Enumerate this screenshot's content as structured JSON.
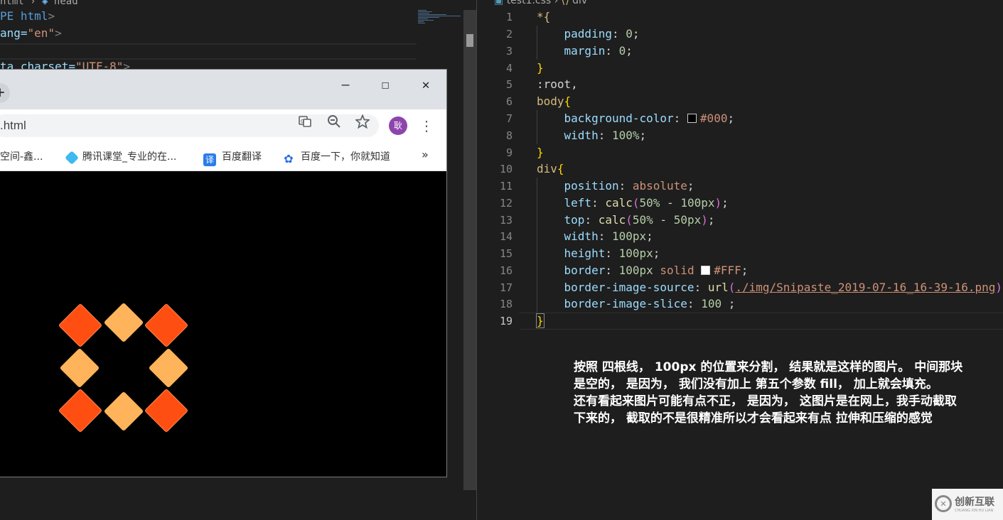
{
  "left_editor": {
    "breadcrumb": {
      "file": "html",
      "sep": "›",
      "node": "head"
    },
    "lines": [
      {
        "a": "PE",
        "b": "html",
        "c": ">"
      },
      {
        "a": "ang=",
        "b": "\"en\"",
        "c": ">"
      },
      {
        "a": "ta charset=",
        "b": "\"UTF-8\"",
        "c": ">"
      }
    ]
  },
  "browser": {
    "url": ".html",
    "window_buttons": {
      "minimize": "—",
      "maximize": "☐",
      "close": "✕"
    },
    "profile_initial": "耿",
    "bookmarks": [
      {
        "label": "空间-鑫...",
        "icon": ""
      },
      {
        "label": "腾讯课堂_专业的在...",
        "icon": "◆"
      },
      {
        "label": "百度翻译",
        "icon": "译"
      },
      {
        "label": "百度一下，你就知道",
        "icon": "✿"
      }
    ],
    "more_bookmarks": "»"
  },
  "right_editor": {
    "breadcrumb": {
      "file": "test1.css",
      "sep": "›",
      "node": "div"
    },
    "line_numbers": [
      "1",
      "2",
      "3",
      "4",
      "5",
      "6",
      "7",
      "8",
      "9",
      "10",
      "11",
      "12",
      "13",
      "14",
      "15",
      "16",
      "17",
      "18",
      "19"
    ],
    "code": {
      "l1": "*{",
      "l2_prop": "padding",
      "l2_val": "0",
      "l3_prop": "margin",
      "l3_val": "0",
      "l4": "}",
      "l5": ":root,",
      "l6_sel": "body",
      "l6_br": "{",
      "l7_prop": "background-color",
      "l7_val": "#000",
      "l8_prop": "width",
      "l8_val": "100%",
      "l9": "}",
      "l10_sel": "div",
      "l10_br": "{",
      "l11_prop": "position",
      "l11_val": "absolute",
      "l12_prop": "left",
      "l12_fn": "calc",
      "l12_a": "50%",
      "l12_op": "-",
      "l12_b": "100px",
      "l13_prop": "top",
      "l13_fn": "calc",
      "l13_a": "50%",
      "l13_op": "-",
      "l13_b": "50px",
      "l14_prop": "width",
      "l14_val": "100px",
      "l15_prop": "height",
      "l15_val": "100px",
      "l16_prop": "border",
      "l16_num": "100px",
      "l16_kw": "solid",
      "l16_color": "#FFF",
      "l17_prop": "border-image-source",
      "l17_fn": "url",
      "l17_url": "./img/Snipaste_2019-07-16_16-39-16.png",
      "l18_prop": "border-image-slice",
      "l18_val": "100",
      "l19": "}"
    }
  },
  "note": {
    "lines": [
      "按照 四根线， 100px 的位置来分割， 结果就是这样的图片。 中间那块",
      "是空的， 是因为， 我们没有加上 第五个参数  fill， 加上就会填充。",
      "还有看起来图片可能有点不正， 是因为， 这图片是在网上，我手动截取",
      "下来的， 截取的不是很精准所以才会看起来有点 拉伸和压缩的感觉"
    ]
  },
  "watermark": {
    "text": "创新互联",
    "sub": "CHUANG XIN HU LIAN"
  },
  "colors": {
    "diamond_red": "#ff4e12",
    "diamond_yellow": "#ffb45c",
    "editor_bg": "#1e1e1e"
  }
}
